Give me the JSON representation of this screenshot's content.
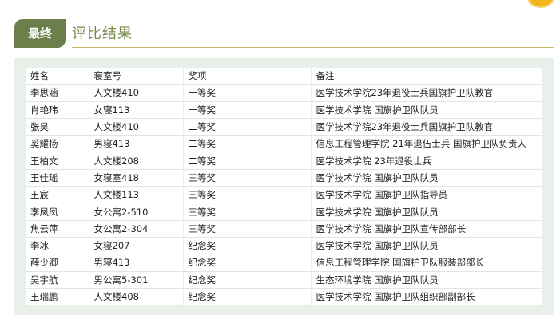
{
  "header": {
    "badge": "最终",
    "title": "评比结果"
  },
  "colors": {
    "badge_bg": "#6b7f4a",
    "title": "#7a8a4e",
    "rule": "#c8b56a",
    "panel_bg": "#e9efe9",
    "corner_dot": "#f4b51c"
  },
  "table": {
    "columns": [
      "姓名",
      "寝室号",
      "奖项",
      "备注"
    ],
    "rows": [
      [
        "李思涵",
        "人文楼410",
        "一等奖",
        "医学技术学院23年退役士兵国旗护卫队教官"
      ],
      [
        "肖艳玮",
        "女寝113",
        "一等奖",
        "医学技术学院 国旗护卫队队员"
      ],
      [
        "张昊",
        "人文楼410",
        "二等奖",
        "医学技术学院23年退役士兵国旗护卫队教官"
      ],
      [
        "奚耀扬",
        "男寝413",
        "二等奖",
        "信息工程管理学院 21年退伍士兵 国旗护卫队负责人"
      ],
      [
        "王柏文",
        "人文楼208",
        "二等奖",
        "医学技术学院 23年退役士兵"
      ],
      [
        "王佳瑶",
        "女寝室418",
        "三等奖",
        "医学技术学院 国旗护卫队队员"
      ],
      [
        "王宸",
        "人文楼113",
        "三等奖",
        "医学技术学院 国旗护卫队指导员"
      ],
      [
        "李凤凤",
        "女公寓2-510",
        "三等奖",
        "医学技术学院 国旗护卫队队员"
      ],
      [
        "焦云萍",
        "女公寓2-304",
        "三等奖",
        "医学技术学院 国旗护卫队宣传部部长"
      ],
      [
        "李冰",
        "女寝207",
        "纪念奖",
        "医学技术学院 国旗护卫队队员"
      ],
      [
        "薛少卿",
        "男寝413",
        "纪念奖",
        "信息工程管理学院 国旗护卫队服装部部长"
      ],
      [
        "吴宇航",
        "男公寓5-301",
        "纪念奖",
        "生态环境学院 国旗护卫队队员"
      ],
      [
        "王瑞鹏",
        "人文楼408",
        "纪念奖",
        "医学技术学院 国旗护卫队组织部副部长"
      ]
    ]
  }
}
